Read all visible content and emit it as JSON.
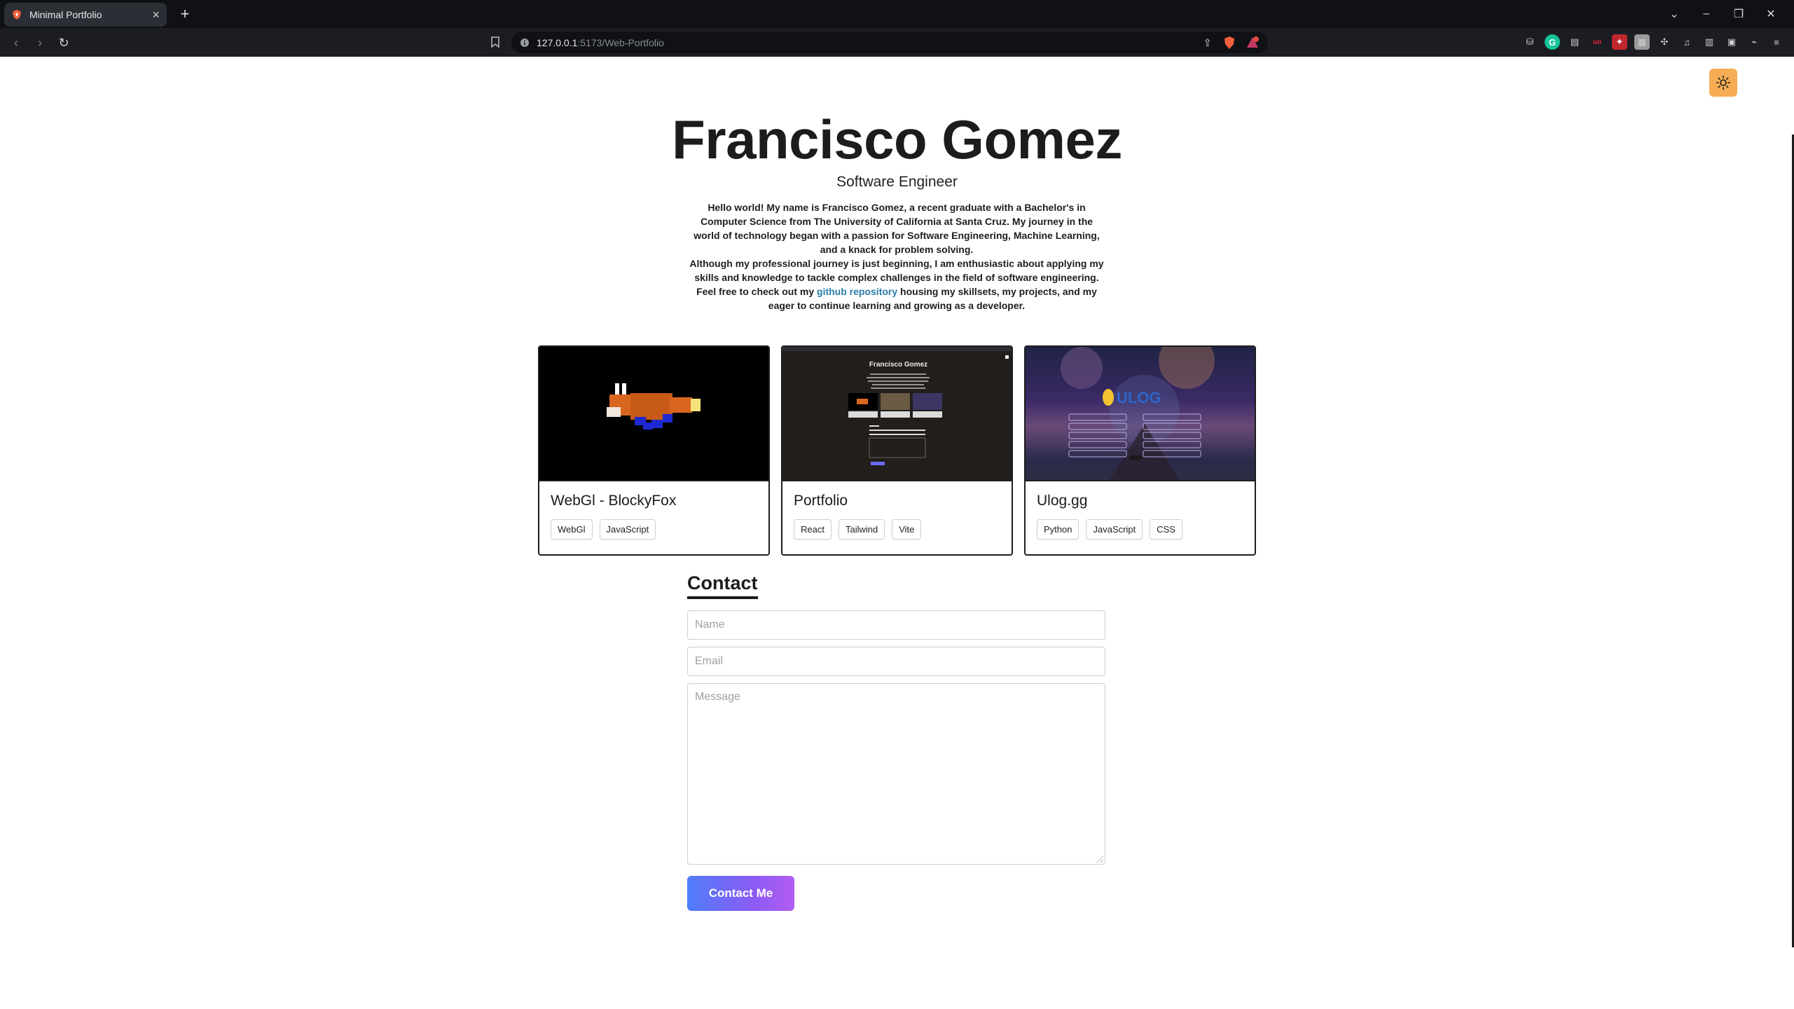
{
  "browser": {
    "tab_title": "Minimal Portfolio",
    "url_host": "127.0.0.1",
    "url_path": ":5173/Web-Portfolio"
  },
  "hero": {
    "name": "Francisco Gomez",
    "role": "Software Engineer",
    "bio_part1": "Hello world! My name is Francisco Gomez, a recent graduate with a Bachelor's in Computer Science from The University of California at Santa Cruz. My journey in the world of technology began with a passion for Software Engineering, Machine Learning, and a knack for problem solving.",
    "bio_part2_before": "Although my professional journey is just beginning, I am enthusiastic about applying my skills and knowledge to tackle complex challenges in the field of software engineering. Feel free to check out my ",
    "bio_link": "github repository",
    "bio_part2_after": " housing my skillsets, my projects, and my eager to continue learning and growing as a developer."
  },
  "projects": [
    {
      "title": "WebGl - BlockyFox",
      "tags": [
        "WebGl",
        "JavaScript"
      ]
    },
    {
      "title": "Portfolio",
      "tags": [
        "React",
        "Tailwind",
        "Vite"
      ]
    },
    {
      "title": "Ulog.gg",
      "tags": [
        "Python",
        "JavaScript",
        "CSS"
      ]
    }
  ],
  "preview_portfolio_title": "Francisco Gomez",
  "contact": {
    "heading": "Contact",
    "name_placeholder": "Name",
    "email_placeholder": "Email",
    "message_placeholder": "Message",
    "button": "Contact Me"
  },
  "colors": {
    "accent_toggle": "#f6ad55",
    "link": "#2b7da8",
    "button_gradient_start": "#4f7df9",
    "button_gradient_end": "#b15cf0"
  }
}
